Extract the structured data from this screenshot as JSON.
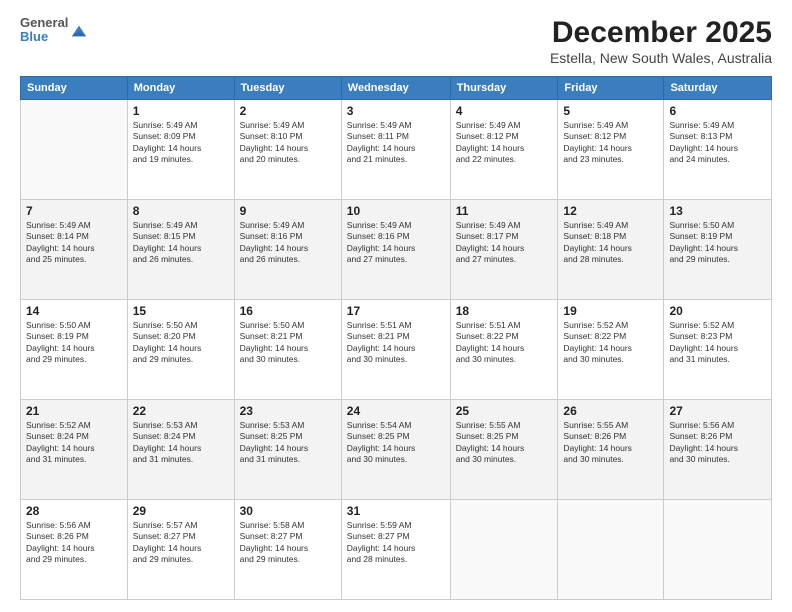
{
  "logo": {
    "line1": "General",
    "line2": "Blue"
  },
  "title": "December 2025",
  "subtitle": "Estella, New South Wales, Australia",
  "headers": [
    "Sunday",
    "Monday",
    "Tuesday",
    "Wednesday",
    "Thursday",
    "Friday",
    "Saturday"
  ],
  "rows": [
    [
      {
        "day": "",
        "info": ""
      },
      {
        "day": "1",
        "info": "Sunrise: 5:49 AM\nSunset: 8:09 PM\nDaylight: 14 hours\nand 19 minutes."
      },
      {
        "day": "2",
        "info": "Sunrise: 5:49 AM\nSunset: 8:10 PM\nDaylight: 14 hours\nand 20 minutes."
      },
      {
        "day": "3",
        "info": "Sunrise: 5:49 AM\nSunset: 8:11 PM\nDaylight: 14 hours\nand 21 minutes."
      },
      {
        "day": "4",
        "info": "Sunrise: 5:49 AM\nSunset: 8:12 PM\nDaylight: 14 hours\nand 22 minutes."
      },
      {
        "day": "5",
        "info": "Sunrise: 5:49 AM\nSunset: 8:12 PM\nDaylight: 14 hours\nand 23 minutes."
      },
      {
        "day": "6",
        "info": "Sunrise: 5:49 AM\nSunset: 8:13 PM\nDaylight: 14 hours\nand 24 minutes."
      }
    ],
    [
      {
        "day": "7",
        "info": "Sunrise: 5:49 AM\nSunset: 8:14 PM\nDaylight: 14 hours\nand 25 minutes."
      },
      {
        "day": "8",
        "info": "Sunrise: 5:49 AM\nSunset: 8:15 PM\nDaylight: 14 hours\nand 26 minutes."
      },
      {
        "day": "9",
        "info": "Sunrise: 5:49 AM\nSunset: 8:16 PM\nDaylight: 14 hours\nand 26 minutes."
      },
      {
        "day": "10",
        "info": "Sunrise: 5:49 AM\nSunset: 8:16 PM\nDaylight: 14 hours\nand 27 minutes."
      },
      {
        "day": "11",
        "info": "Sunrise: 5:49 AM\nSunset: 8:17 PM\nDaylight: 14 hours\nand 27 minutes."
      },
      {
        "day": "12",
        "info": "Sunrise: 5:49 AM\nSunset: 8:18 PM\nDaylight: 14 hours\nand 28 minutes."
      },
      {
        "day": "13",
        "info": "Sunrise: 5:50 AM\nSunset: 8:19 PM\nDaylight: 14 hours\nand 29 minutes."
      }
    ],
    [
      {
        "day": "14",
        "info": "Sunrise: 5:50 AM\nSunset: 8:19 PM\nDaylight: 14 hours\nand 29 minutes."
      },
      {
        "day": "15",
        "info": "Sunrise: 5:50 AM\nSunset: 8:20 PM\nDaylight: 14 hours\nand 29 minutes."
      },
      {
        "day": "16",
        "info": "Sunrise: 5:50 AM\nSunset: 8:21 PM\nDaylight: 14 hours\nand 30 minutes."
      },
      {
        "day": "17",
        "info": "Sunrise: 5:51 AM\nSunset: 8:21 PM\nDaylight: 14 hours\nand 30 minutes."
      },
      {
        "day": "18",
        "info": "Sunrise: 5:51 AM\nSunset: 8:22 PM\nDaylight: 14 hours\nand 30 minutes."
      },
      {
        "day": "19",
        "info": "Sunrise: 5:52 AM\nSunset: 8:22 PM\nDaylight: 14 hours\nand 30 minutes."
      },
      {
        "day": "20",
        "info": "Sunrise: 5:52 AM\nSunset: 8:23 PM\nDaylight: 14 hours\nand 31 minutes."
      }
    ],
    [
      {
        "day": "21",
        "info": "Sunrise: 5:52 AM\nSunset: 8:24 PM\nDaylight: 14 hours\nand 31 minutes."
      },
      {
        "day": "22",
        "info": "Sunrise: 5:53 AM\nSunset: 8:24 PM\nDaylight: 14 hours\nand 31 minutes."
      },
      {
        "day": "23",
        "info": "Sunrise: 5:53 AM\nSunset: 8:25 PM\nDaylight: 14 hours\nand 31 minutes."
      },
      {
        "day": "24",
        "info": "Sunrise: 5:54 AM\nSunset: 8:25 PM\nDaylight: 14 hours\nand 30 minutes."
      },
      {
        "day": "25",
        "info": "Sunrise: 5:55 AM\nSunset: 8:25 PM\nDaylight: 14 hours\nand 30 minutes."
      },
      {
        "day": "26",
        "info": "Sunrise: 5:55 AM\nSunset: 8:26 PM\nDaylight: 14 hours\nand 30 minutes."
      },
      {
        "day": "27",
        "info": "Sunrise: 5:56 AM\nSunset: 8:26 PM\nDaylight: 14 hours\nand 30 minutes."
      }
    ],
    [
      {
        "day": "28",
        "info": "Sunrise: 5:56 AM\nSunset: 8:26 PM\nDaylight: 14 hours\nand 29 minutes."
      },
      {
        "day": "29",
        "info": "Sunrise: 5:57 AM\nSunset: 8:27 PM\nDaylight: 14 hours\nand 29 minutes."
      },
      {
        "day": "30",
        "info": "Sunrise: 5:58 AM\nSunset: 8:27 PM\nDaylight: 14 hours\nand 29 minutes."
      },
      {
        "day": "31",
        "info": "Sunrise: 5:59 AM\nSunset: 8:27 PM\nDaylight: 14 hours\nand 28 minutes."
      },
      {
        "day": "",
        "info": ""
      },
      {
        "day": "",
        "info": ""
      },
      {
        "day": "",
        "info": ""
      }
    ]
  ]
}
